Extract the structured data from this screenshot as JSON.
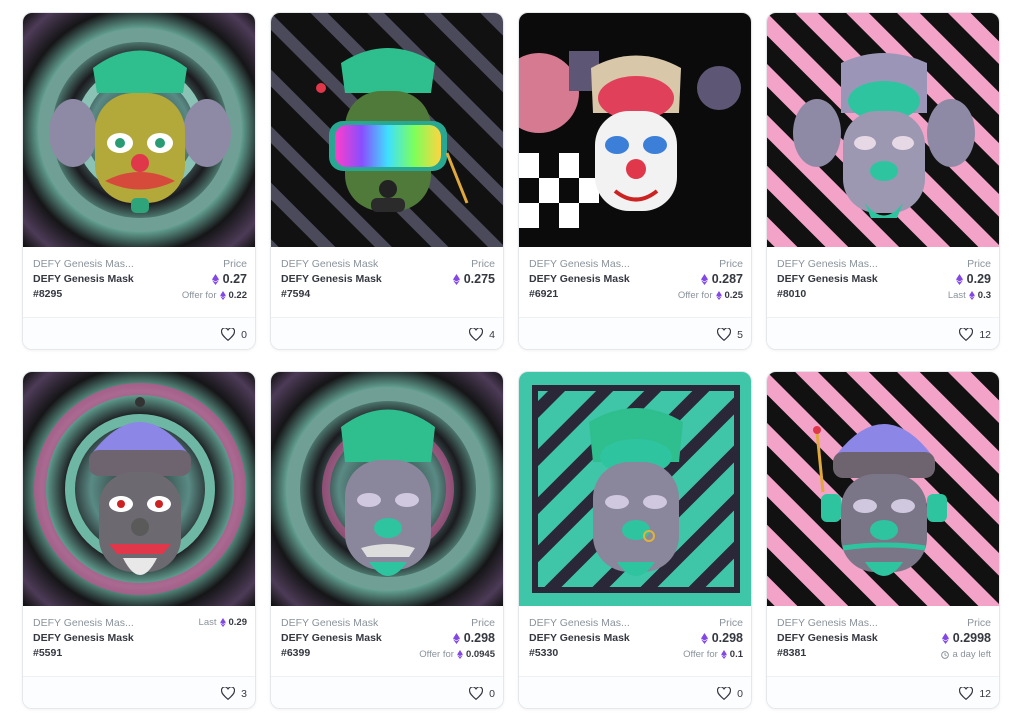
{
  "colors": {
    "eth": "#8247e5",
    "muted": "#8a939b",
    "text": "#353840",
    "border": "#e5e8eb"
  },
  "cards": [
    {
      "collection": "DEFY Genesis Mas...",
      "title": "DEFY Genesis Mask",
      "token": "#8295",
      "price_label": "Price",
      "price": "0.27",
      "sub_label": "Offer for",
      "sub_value": "0.22",
      "likes": "0",
      "art": "maze-green-mask-yellow"
    },
    {
      "collection": "DEFY Genesis Mask",
      "title": "DEFY Genesis Mask",
      "token": "#7594",
      "price_label": "Price",
      "price": "0.275",
      "likes": "4",
      "art": "dark-stripes-rainbow-visor"
    },
    {
      "collection": "DEFY Genesis Mas...",
      "title": "DEFY Genesis Mask",
      "token": "#6921",
      "price_label": "Price",
      "price": "0.287",
      "sub_label": "Offer for",
      "sub_value": "0.25",
      "likes": "5",
      "art": "black-checker-brain-clown"
    },
    {
      "collection": "DEFY Genesis Mas...",
      "title": "DEFY Genesis Mask",
      "token": "#8010",
      "price_label": "Price",
      "price": "0.29",
      "sub_label": "Last",
      "sub_value": "0.3",
      "likes": "12",
      "art": "pink-maze-brain-grey"
    },
    {
      "collection": "DEFY Genesis Mas...",
      "title": "DEFY Genesis Mask",
      "token": "#5591",
      "top_label": "Last",
      "top_value": "0.29",
      "likes": "3",
      "art": "maze-beanie-clown"
    },
    {
      "collection": "DEFY Genesis Mask",
      "title": "DEFY Genesis Mask",
      "token": "#6399",
      "price_label": "Price",
      "price": "0.298",
      "sub_label": "Offer for",
      "sub_value": "0.0945",
      "likes": "0",
      "art": "maze-green-hair-grey"
    },
    {
      "collection": "DEFY Genesis Mas...",
      "title": "DEFY Genesis Mask",
      "token": "#5330",
      "price_label": "Price",
      "price": "0.298",
      "sub_label": "Offer for",
      "sub_value": "0.1",
      "likes": "0",
      "art": "teal-stripes-grey"
    },
    {
      "collection": "DEFY Genesis Mas...",
      "title": "DEFY Genesis Mask",
      "token": "#8381",
      "price_label": "Price",
      "price": "0.2998",
      "time_left": "a day left",
      "likes": "12",
      "art": "pink-maze-beanie-headset"
    }
  ]
}
